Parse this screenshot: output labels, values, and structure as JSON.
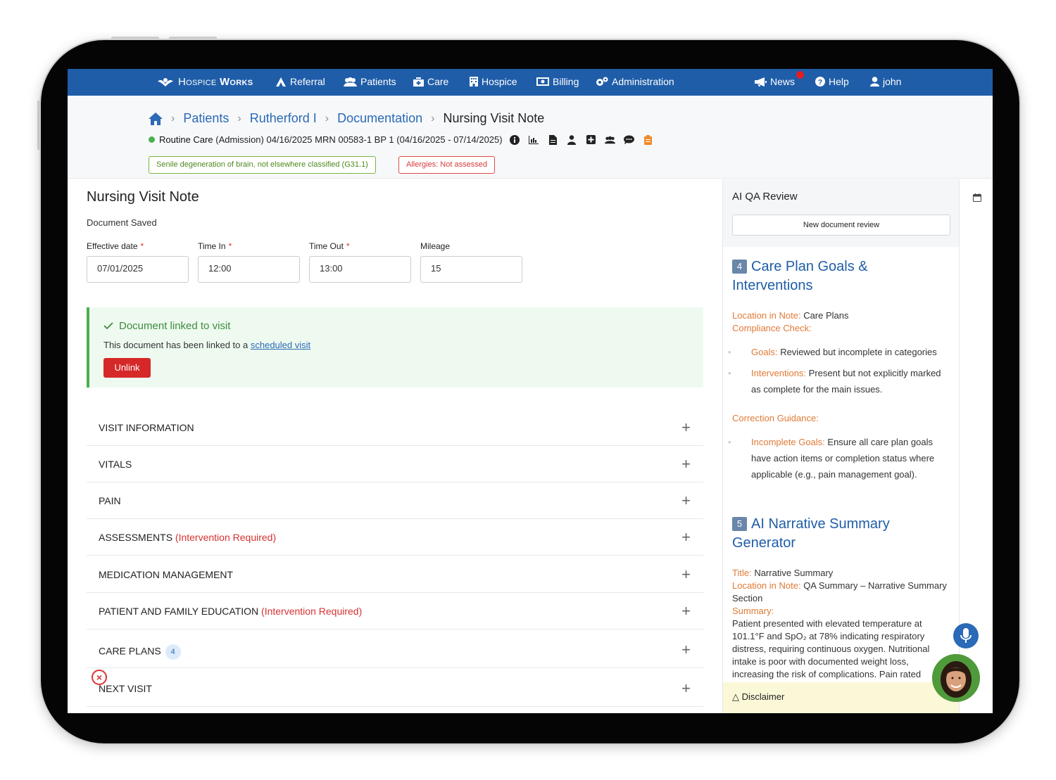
{
  "nav": {
    "brand_prefix": "Hospice",
    "brand_suffix": "Works",
    "items": [
      {
        "label": "Referral",
        "icon": "referral-icon"
      },
      {
        "label": "Patients",
        "icon": "patients-icon"
      },
      {
        "label": "Care",
        "icon": "care-icon"
      },
      {
        "label": "Hospice",
        "icon": "hospice-icon"
      },
      {
        "label": "Billing",
        "icon": "billing-icon"
      },
      {
        "label": "Administration",
        "icon": "gears-icon"
      }
    ],
    "news": "News",
    "help": "Help",
    "user": "john"
  },
  "breadcrumb": {
    "items": [
      "Patients",
      "Rutherford I",
      "Documentation"
    ],
    "current": "Nursing Visit Note"
  },
  "patient": {
    "episode": "Routine Care",
    "details": "(Admission) 04/16/2025 MRN 00583-1 BP 1 (04/16/2025 - 07/14/2025)",
    "diagnosis": "Senile degeneration of brain, not elsewhere classified (G31.1)",
    "allergies": "Allergies: Not assessed"
  },
  "document": {
    "title": "Nursing Visit Note",
    "status": "Document Saved",
    "fields": [
      {
        "label": "Effective date",
        "required": true,
        "value": "07/01/2025"
      },
      {
        "label": "Time In",
        "required": true,
        "value": "12:00"
      },
      {
        "label": "Time Out",
        "required": true,
        "value": "13:00"
      },
      {
        "label": "Mileage",
        "required": false,
        "value": "15"
      }
    ],
    "linked": {
      "title": "Document linked to visit",
      "text": "This document has been linked to a ",
      "link": "scheduled visit",
      "button": "Unlink"
    },
    "sections": [
      {
        "label": "VISIT INFORMATION",
        "note": ""
      },
      {
        "label": "VITALS",
        "note": ""
      },
      {
        "label": "PAIN",
        "note": ""
      },
      {
        "label": "ASSESSMENTS",
        "note": "(Intervention Required)"
      },
      {
        "label": "MEDICATION MANAGEMENT",
        "note": ""
      },
      {
        "label": "PATIENT AND FAMILY EDUCATION",
        "note": "(Intervention Required)"
      },
      {
        "label": "CARE PLANS",
        "note": "",
        "badge": "4"
      },
      {
        "label": "NEXT VISIT",
        "note": ""
      }
    ]
  },
  "ai": {
    "title": "AI QA Review",
    "button": "New document review",
    "s4": {
      "num": "4",
      "title": "Care Plan Goals & Interventions",
      "loc_label": "Location in Note:",
      "loc_value": " Care Plans",
      "check_label": "Compliance Check:",
      "b1_label": "Goals:",
      "b1_text": " Reviewed but incomplete in categories",
      "b2_label": "Interventions:",
      "b2_text": " Present but not explicitly marked as complete for the main issues.",
      "guide_label": "Correction Guidance:",
      "b3_label": "Incomplete Goals:",
      "b3_text": " Ensure all care plan goals have action items or completion status where applicable (e.g., pain management goal)."
    },
    "s5": {
      "num": "5",
      "title": "AI Narrative Summary Generator",
      "title_label": "Title:",
      "title_value": " Narrative Summary",
      "loc_label": "Location in Note:",
      "loc_value": " QA Summary – Narrative Summary Section",
      "summary_label": "Summary:",
      "summary_text": "Patient presented with elevated temperature at 101.1°F and SpO₂ at 78% indicating respiratory distress, requiring continuous oxygen. Nutritional intake is poor with documented weight loss, increasing the risk of complications. Pain rated"
    },
    "disclaimer": "Disclaimer"
  },
  "colors": {
    "nav": "#1f5da8",
    "accent": "#2a6ab6",
    "warning": "#e07a36",
    "danger": "#d62828",
    "success": "#4caf50"
  }
}
